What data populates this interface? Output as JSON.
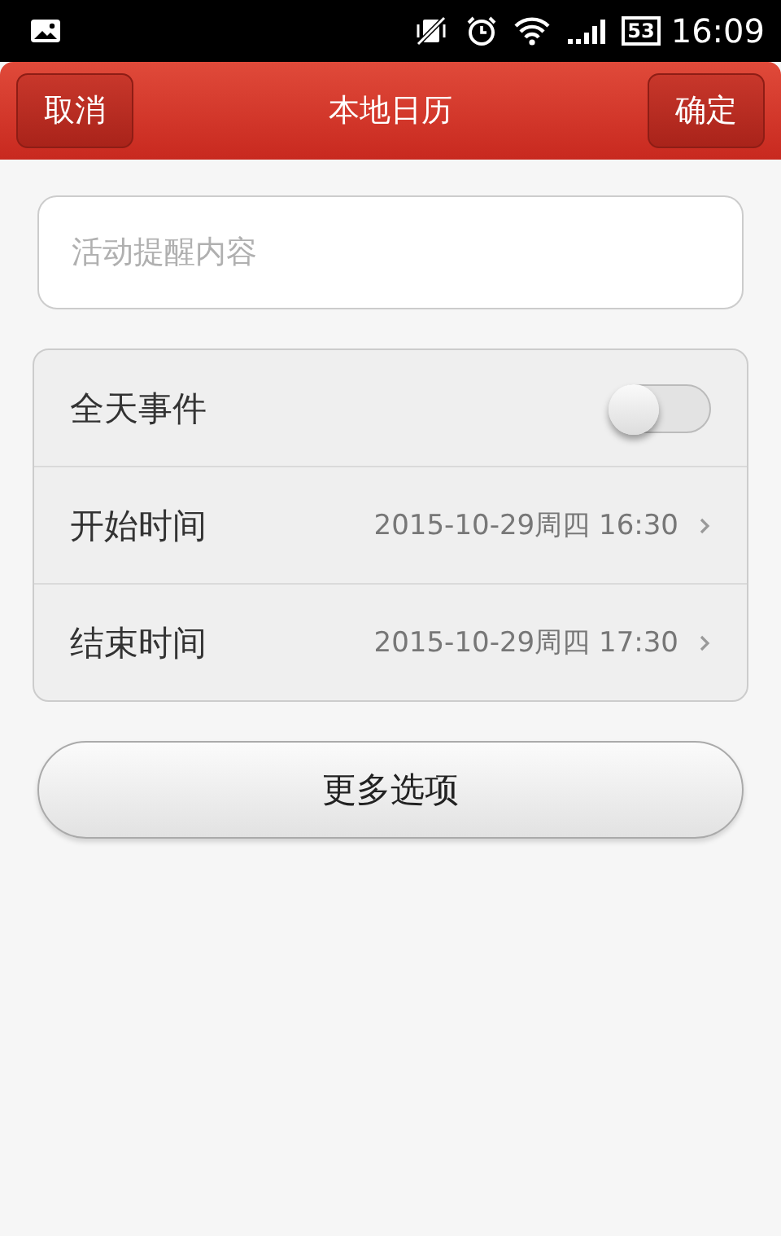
{
  "status_bar": {
    "battery": "53",
    "time": "16:09"
  },
  "header": {
    "title": "本地日历",
    "left_button": "取消",
    "right_button": "确定"
  },
  "title_field": {
    "placeholder": "活动提醒内容"
  },
  "settings": [
    {
      "kind": "toggle",
      "label": "全天事件",
      "on": false
    },
    {
      "kind": "datetime",
      "label": "开始时间",
      "value": "2015-10-29周四 16:30"
    },
    {
      "kind": "datetime",
      "label": "结束时间",
      "value": "2015-10-29周四 17:30"
    }
  ],
  "more_button": "更多选项"
}
